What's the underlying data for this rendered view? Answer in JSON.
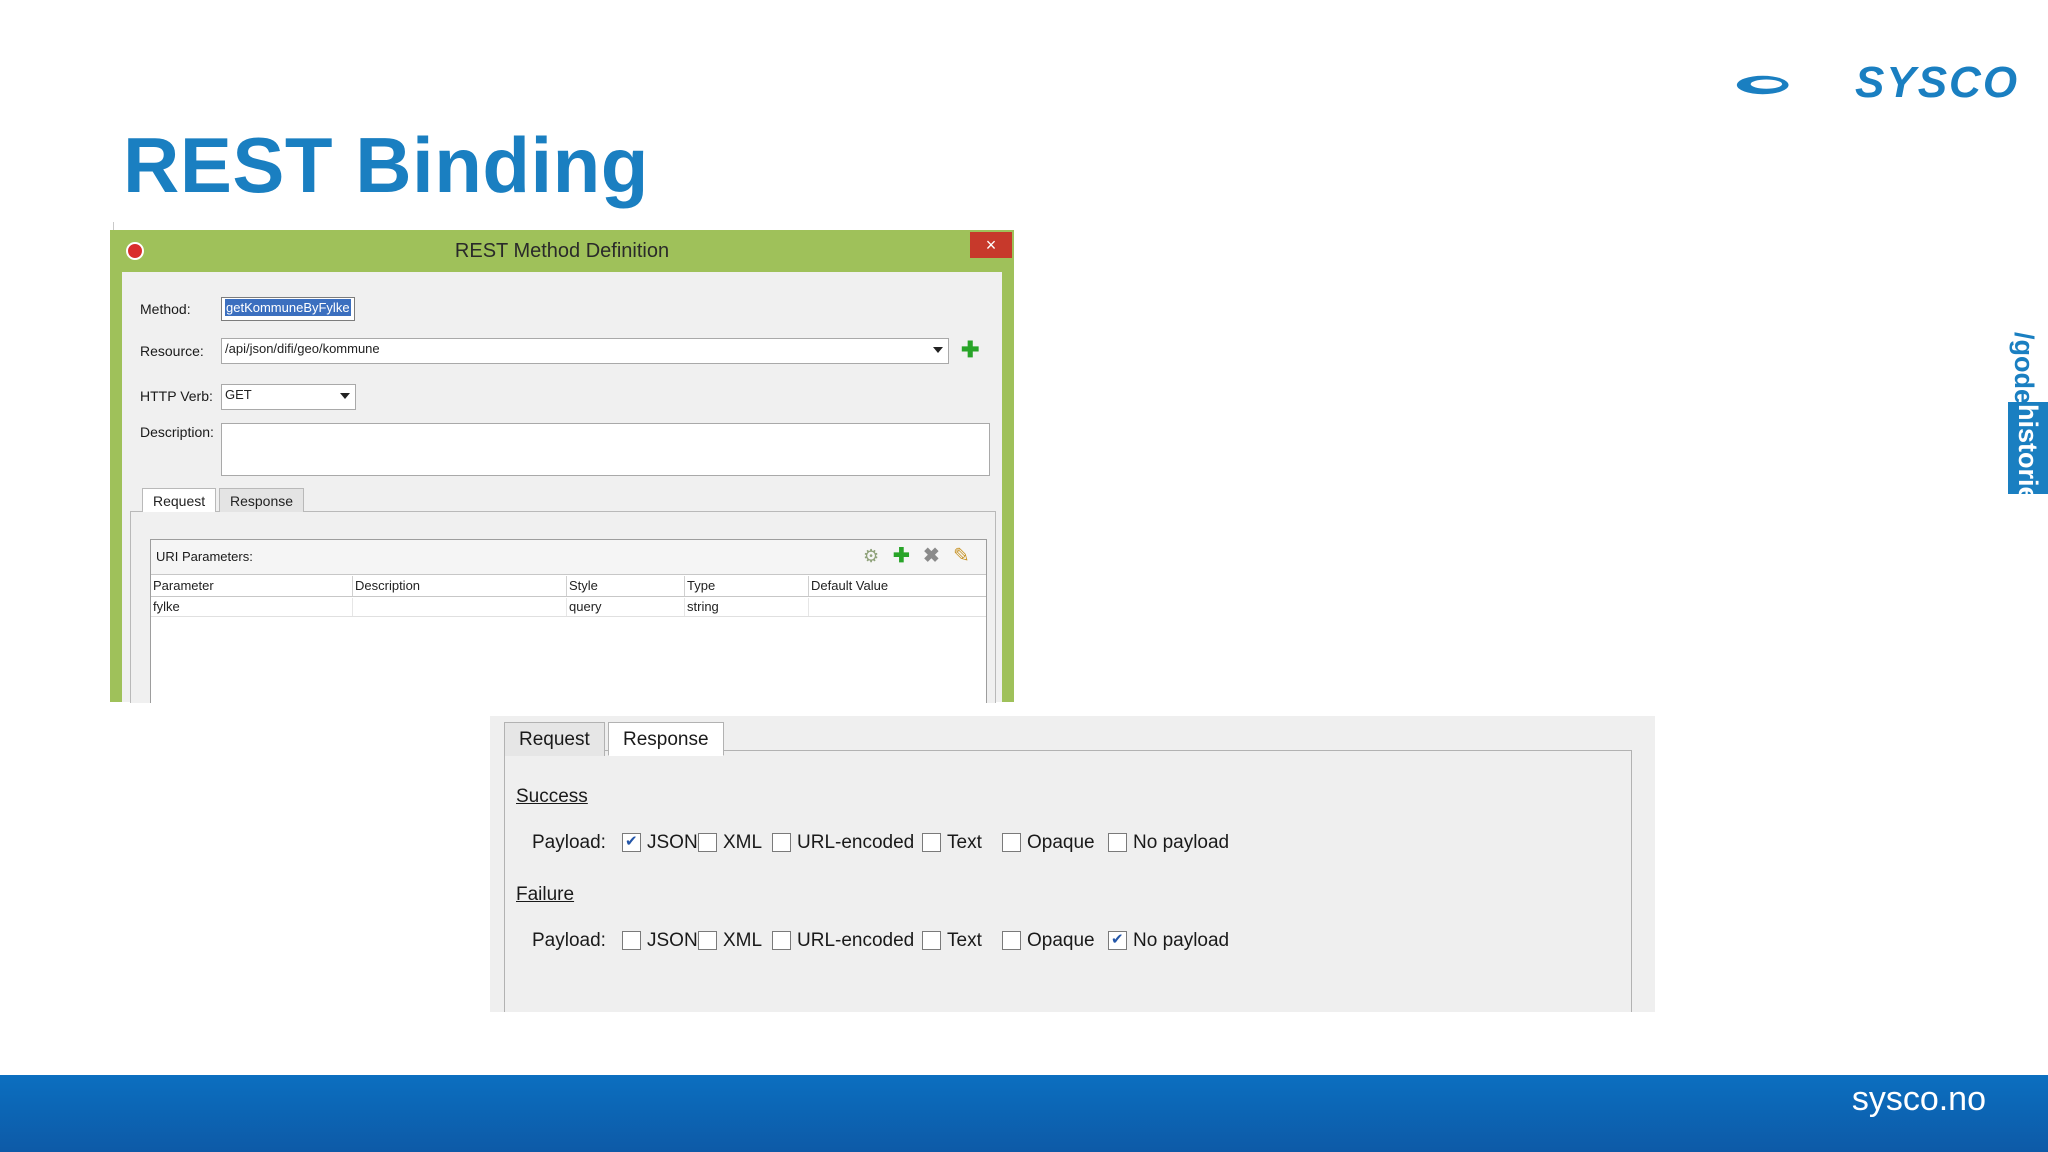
{
  "slide": {
    "title": "REST Binding",
    "logo_text": "SYSCO",
    "side_tag_light": "/gode",
    "side_tag_dark": "historier",
    "footer_url": "sysco.no"
  },
  "dialog": {
    "title": "REST Method Definition",
    "close_glyph": "×",
    "method_label": "Method:",
    "method_value": "getKommuneByFylke",
    "resource_label": "Resource:",
    "resource_value": "/api/json/difi/geo/kommune",
    "verb_label": "HTTP Verb:",
    "verb_value": "GET",
    "description_label": "Description:",
    "description_value": "",
    "tabs": [
      "Request",
      "Response"
    ],
    "uri_parameters_label": "URI Parameters:",
    "columns": [
      "Parameter",
      "Description",
      "Style",
      "Type",
      "Default Value"
    ],
    "rows": [
      [
        "fylke",
        "",
        "query",
        "string",
        ""
      ]
    ]
  },
  "response_panel": {
    "tabs": [
      "Request",
      "Response"
    ],
    "active_tab": "Response",
    "success_label": "Success",
    "failure_label": "Failure",
    "payload_label": "Payload:",
    "options": [
      "JSON",
      "XML",
      "URL-encoded",
      "Text",
      "Opaque",
      "No payload"
    ],
    "success_checked": [
      true,
      false,
      false,
      false,
      false,
      false
    ],
    "failure_checked": [
      false,
      false,
      false,
      false,
      false,
      true
    ]
  },
  "colors": {
    "brand_blue": "#1a7fc1",
    "dialog_frame": "#9fc15a",
    "close_red": "#c7392b"
  }
}
